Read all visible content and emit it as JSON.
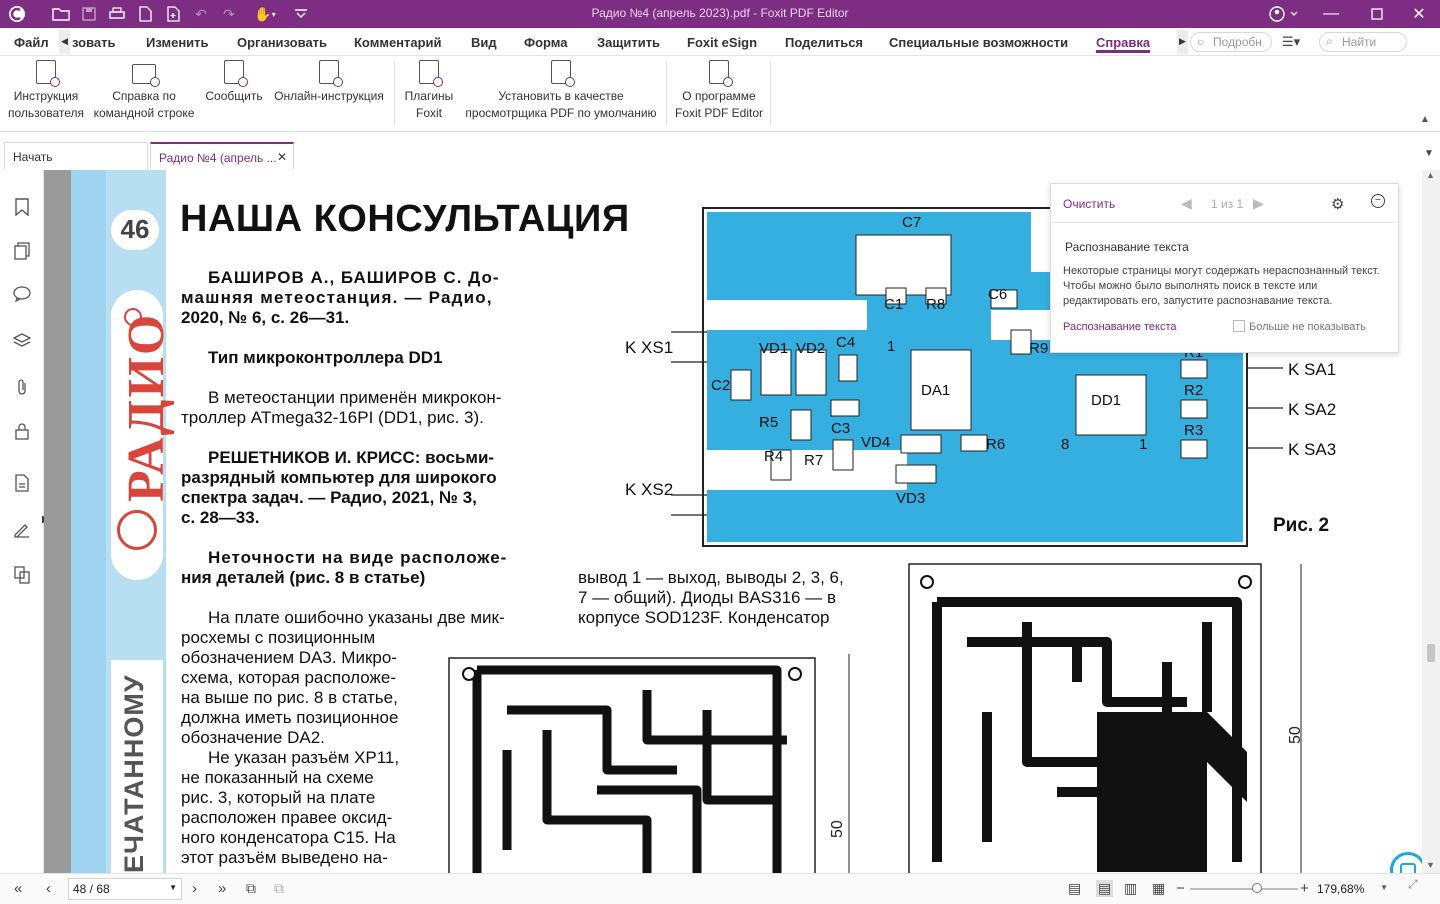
{
  "titlebar": {
    "title": "Радио №4 (апрель 2023).pdf - Foxit PDF Editor"
  },
  "colors": {
    "brand": "#7d2d82",
    "pcb_blue": "#35aee0",
    "magazine_stripe": "#9fd3ef",
    "logo_red": "#d8453a"
  },
  "menu": {
    "items": [
      "Файл",
      "зовать",
      "Изменить",
      "Организовать",
      "Комментарий",
      "Вид",
      "Форма",
      "Защитить",
      "Foxit eSign",
      "Поделиться",
      "Специальные возможности",
      "Справка"
    ],
    "tell_me": "Подробн",
    "search": "Найти"
  },
  "ribbon": {
    "buttons": [
      {
        "line1": "Инструкция",
        "line2": "пользователя"
      },
      {
        "line1": "Справка по",
        "line2": "командной строке"
      },
      {
        "line1": "Сообщить",
        "line2": ""
      },
      {
        "line1": "Онлайн-инструкция",
        "line2": ""
      },
      {
        "line1": "Плагины",
        "line2": "Foxit"
      },
      {
        "line1": "Установить в качестве",
        "line2": "просмотрщика PDF по умолчанию"
      },
      {
        "line1": "О программе",
        "line2": "Foxit PDF Editor"
      }
    ]
  },
  "tabs": {
    "start": "Начать",
    "doc": "Радио №4 (апрель ..."
  },
  "status": {
    "page": "48 / 68",
    "zoom": "179,68%"
  },
  "search_popup": {
    "clear": "Очистить",
    "counter": "1 из 1",
    "heading": "Распознавание текста",
    "body": "Некоторые страницы могут содержать нераспознанный текст. Чтобы можно было выполнять поиск в тексте или редактировать его, запустите распознавание текста.",
    "link": "Распознавание текста",
    "checkbox": "Больше не показывать"
  },
  "article": {
    "page_number": "46",
    "logo": "РАДИО",
    "side_text": "ЕЧАТАННОМУ",
    "heading": "НАША КОНСУЛЬТАЦИЯ",
    "p1": "БАШИРОВ А., БАШИРОВ С. До-",
    "p1b": "машняя метеостанция. — Радио,",
    "p1c": "2020, № 6, с. 26—31.",
    "h2": "Тип микроконтроллера DD1",
    "p2a": "В метеостанции применён микрокон-",
    "p2b": "троллер ATmega32-16PI (DD1, рис. 3).",
    "p3a": "РЕШЕТНИКОВ И. КРИСС: восьми-",
    "p3b": "разрядный компьютер для широкого",
    "p3c": "спектра задач. — Радио, 2021, № 3,",
    "p3d": "с. 28—33.",
    "h3a": "Неточности на виде расположе-",
    "h3b": "ния деталей (рис. 8 в статье)",
    "p4": [
      "На плате ошибочно указаны две мик-",
      "росхемы с позиционным",
      "обозначением DA3. Микро-",
      "схема, которая расположе-",
      "на выше по рис. 8 в статье,",
      "должна иметь позиционное",
      "обозначение DA2.",
      "Не указан разъём XP11,",
      "не показанный на схеме",
      "рис. 3, который на плате",
      "расположен правее оксид-",
      "ного конденсатора C15. На",
      "этот разъём выведено на-"
    ],
    "p5": [
      "вывод 1 — выход, выводы 2, 3, 6,",
      "7 — общий). Диоды BAS316 — в",
      "корпусе SOD123F. Конденсатор"
    ],
    "fig_caption": "Рис. 2",
    "pcb_labels": {
      "c7": "C7",
      "c1": "C1",
      "r8": "R8",
      "c6": "C6",
      "vd1": "VD1",
      "vd2": "VD2",
      "c4": "C4",
      "r9": "R9",
      "c2": "C2",
      "da1": "DA1",
      "dd1": "DD1",
      "r1": "R1",
      "r2": "R2",
      "r3": "R3",
      "r5": "R5",
      "c3": "C3",
      "vd4": "VD4",
      "r6": "R6",
      "r4": "R4",
      "r7": "R7",
      "vd3": "VD3",
      "pin1": "1",
      "pin8": "8",
      "pin1b": "1"
    },
    "connectors": {
      "xs1": "K XS1",
      "xs2": "K XS2",
      "sa1": "K SA1",
      "sa2": "K SA2",
      "sa3": "K SA3"
    },
    "dim1": "50",
    "dim2": "50"
  }
}
